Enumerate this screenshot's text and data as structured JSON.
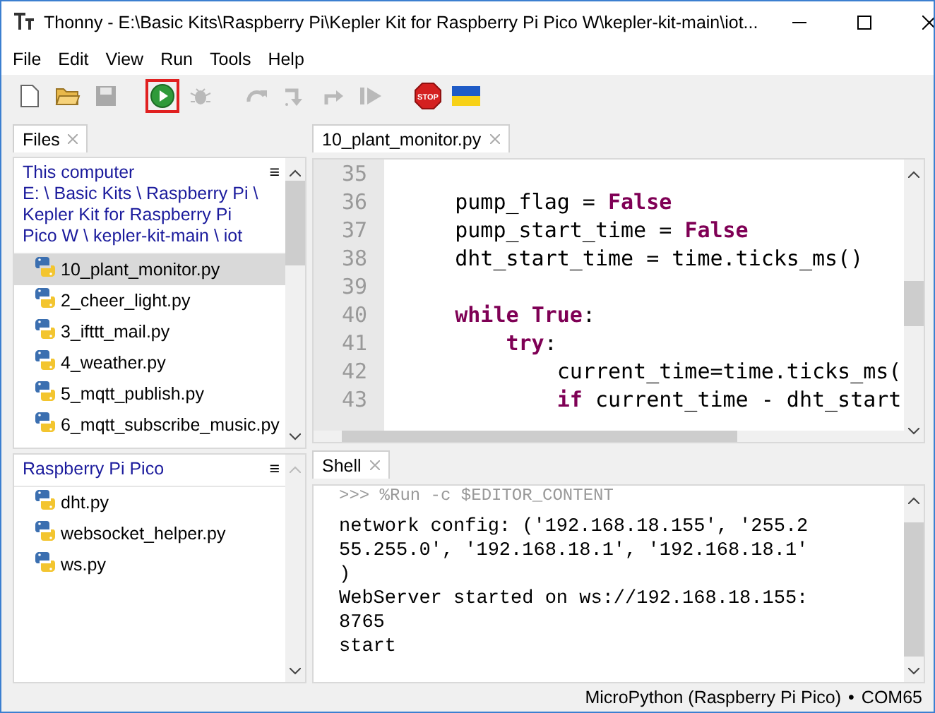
{
  "window": {
    "title": "Thonny  -  E:\\Basic Kits\\Raspberry Pi\\Kepler Kit for Raspberry Pi Pico W\\kepler-kit-main\\iot..."
  },
  "menu": [
    "File",
    "Edit",
    "View",
    "Run",
    "Tools",
    "Help"
  ],
  "toolbar": [
    {
      "kind": "new",
      "disabled": false,
      "highlighted": false
    },
    {
      "kind": "open",
      "disabled": false,
      "highlighted": false
    },
    {
      "kind": "save",
      "disabled": true,
      "highlighted": false
    },
    {
      "kind": "run",
      "disabled": false,
      "highlighted": true
    },
    {
      "kind": "debug",
      "disabled": true,
      "highlighted": false
    },
    {
      "kind": "step-over",
      "disabled": true,
      "highlighted": false
    },
    {
      "kind": "step-into",
      "disabled": true,
      "highlighted": false
    },
    {
      "kind": "step-out",
      "disabled": true,
      "highlighted": false
    },
    {
      "kind": "resume",
      "disabled": true,
      "highlighted": false
    },
    {
      "kind": "stop",
      "disabled": false,
      "highlighted": false,
      "label": "STOP"
    },
    {
      "kind": "flag",
      "disabled": false,
      "highlighted": false
    }
  ],
  "files_panel": {
    "tab": "Files",
    "menu_glyph": "≡",
    "local": {
      "title": "This computer",
      "path": "E: \\ Basic Kits \\ Raspberry Pi \\ Kepler Kit for Raspberry Pi Pico W \\ kepler-kit-main \\ iot",
      "items": [
        {
          "name": "10_plant_monitor.py",
          "selected": true
        },
        {
          "name": "2_cheer_light.py",
          "selected": false
        },
        {
          "name": "3_ifttt_mail.py",
          "selected": false
        },
        {
          "name": "4_weather.py",
          "selected": false
        },
        {
          "name": "5_mqtt_publish.py",
          "selected": false
        },
        {
          "name": "6_mqtt_subscribe_music.py",
          "selected": false
        }
      ]
    },
    "device": {
      "title": "Raspberry Pi Pico",
      "items": [
        {
          "name": "dht.py",
          "selected": false
        },
        {
          "name": "websocket_helper.py",
          "selected": false
        },
        {
          "name": "ws.py",
          "selected": false
        }
      ]
    }
  },
  "editor": {
    "tab": "10_plant_monitor.py",
    "lines": [
      {
        "number": "35"
      },
      {
        "number": "36",
        "code": "    pump_flag = **False**"
      },
      {
        "number": "37",
        "code": "    pump_start_time = **False**"
      },
      {
        "number": "38",
        "code": "    dht_start_time = time.ticks_ms()"
      },
      {
        "number": "39"
      },
      {
        "number": "40",
        "code": "    **while** **True**:"
      },
      {
        "number": "41",
        "code": "        **try**:"
      },
      {
        "number": "42",
        "code": "            current_time=time.ticks_ms("
      },
      {
        "number": "43",
        "code": "            **if** current_time - dht_start"
      }
    ]
  },
  "shell": {
    "tab": "Shell",
    "command": ">>> %Run -c $EDITOR_CONTENT",
    "output": [
      "network config: ('192.168.18.155', '255.2",
      "55.255.0', '192.168.18.1', '192.168.18.1'",
      ")",
      "WebServer started on ws://192.168.18.155:",
      "8765",
      "start"
    ]
  },
  "status_bar": {
    "interpreter": "MicroPython (Raspberry Pi Pico)",
    "separator": "•",
    "port": "COM65"
  }
}
